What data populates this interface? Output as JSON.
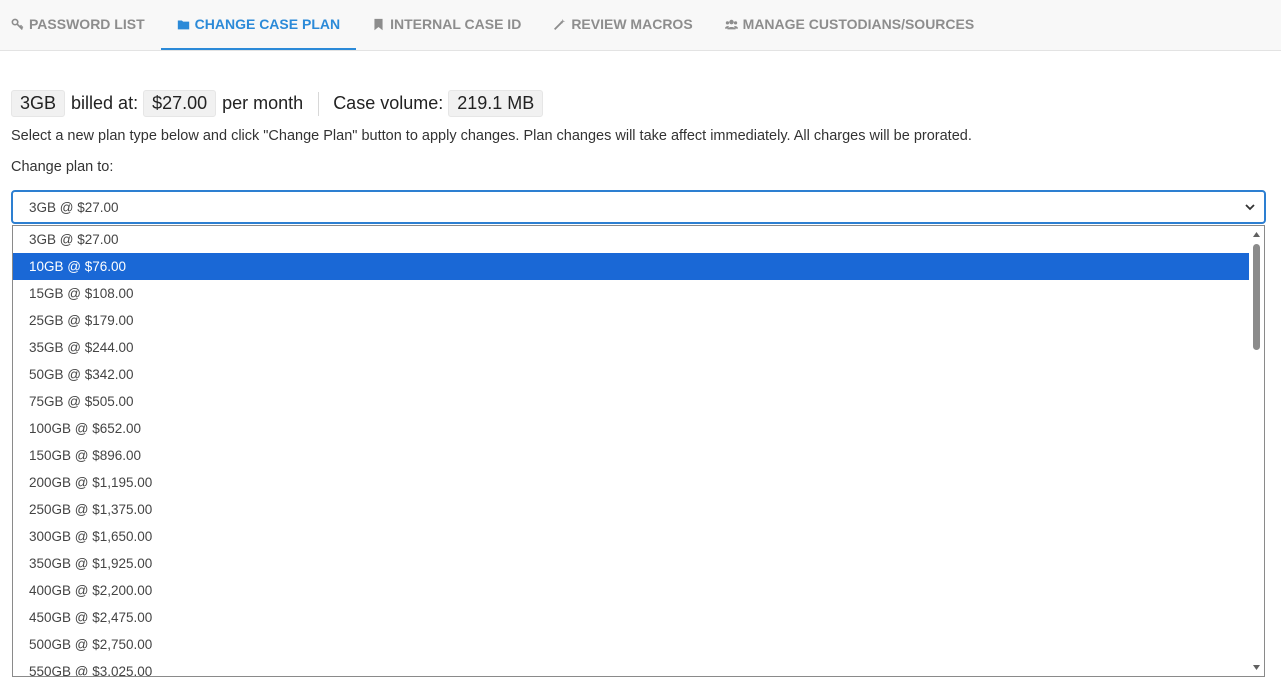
{
  "tabs": [
    {
      "label": "PASSWORD LIST",
      "icon": "key-icon",
      "active": false
    },
    {
      "label": "CHANGE CASE PLAN",
      "icon": "folder-icon",
      "active": true
    },
    {
      "label": "INTERNAL CASE ID",
      "icon": "bookmark-icon",
      "active": false
    },
    {
      "label": "REVIEW MACROS",
      "icon": "magic-wand-icon",
      "active": false
    },
    {
      "label": "MANAGE CUSTODIANS/SOURCES",
      "icon": "users-icon",
      "active": false
    }
  ],
  "summary": {
    "plan_size": "3GB",
    "billed_label": "billed at:",
    "price": "$27.00",
    "period": "per month",
    "volume_label": "Case volume:",
    "volume": "219.1 MB"
  },
  "instructions": "Select a new plan type below and click \"Change Plan\" button to apply changes. Plan changes will take affect immediately. All charges will be prorated.",
  "change_label": "Change plan to:",
  "select": {
    "selected_value": "3GB @ $27.00",
    "highlighted_index": 1,
    "options": [
      "3GB @ $27.00",
      "10GB @ $76.00",
      "15GB @ $108.00",
      "25GB @ $179.00",
      "35GB @ $244.00",
      "50GB @ $342.00",
      "75GB @ $505.00",
      "100GB @ $652.00",
      "150GB @ $896.00",
      "200GB @ $1,195.00",
      "250GB @ $1,375.00",
      "300GB @ $1,650.00",
      "350GB @ $1,925.00",
      "400GB @ $2,200.00",
      "450GB @ $2,475.00",
      "500GB @ $2,750.00",
      "550GB @ $3,025.00"
    ]
  },
  "colors": {
    "accent": "#2b8ad8",
    "highlight": "#1a68d6",
    "tab_inactive": "#8d8d8d"
  }
}
